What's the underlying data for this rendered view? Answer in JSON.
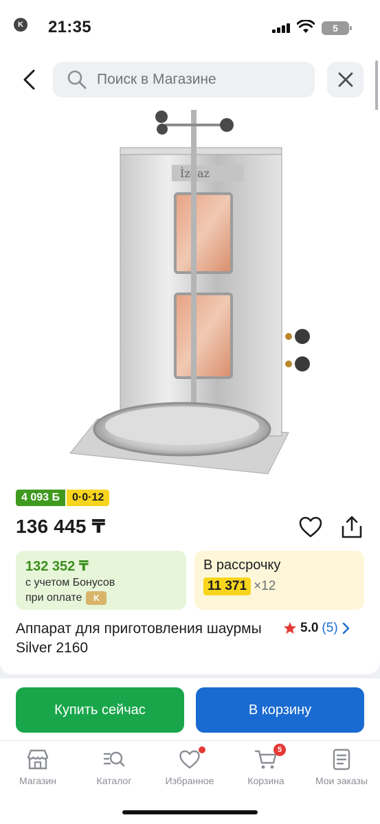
{
  "status": {
    "back_app": "Kaspi.kz",
    "time": "21:35",
    "battery": "5"
  },
  "header": {
    "search_placeholder": "Поиск в Магазине"
  },
  "product": {
    "bonus_badge": "4 093 Б",
    "installment_badge": "0·0·12",
    "price": "136 445 ₸",
    "bonus_price": "132 352 ₸",
    "bonus_note_1": "с учетом Бонусов",
    "bonus_note_2": "при оплате",
    "installment_title": "В рассрочку",
    "installment_amount": "11 371",
    "installment_multiplier": "×12",
    "title": "Аппарат для приготовления шаурмы Silver 2160",
    "rating": "5.0",
    "reviews": "(5)",
    "image_brand": "İzgaz"
  },
  "actions": {
    "buy_now": "Купить сейчас",
    "add_to_cart": "В корзину"
  },
  "tabs": [
    {
      "label": "Магазин",
      "icon": "store-icon"
    },
    {
      "label": "Каталог",
      "icon": "catalog-search-icon"
    },
    {
      "label": "Избранное",
      "icon": "heart-icon"
    },
    {
      "label": "Корзина",
      "icon": "cart-icon",
      "badge": "5"
    },
    {
      "label": "Мои заказы",
      "icon": "orders-icon"
    }
  ],
  "colors": {
    "primary_blue": "#1a6bd1",
    "buy_green": "#19a64b",
    "bonus_green": "#3f9a1f",
    "installment_yellow": "#f7d51d"
  }
}
